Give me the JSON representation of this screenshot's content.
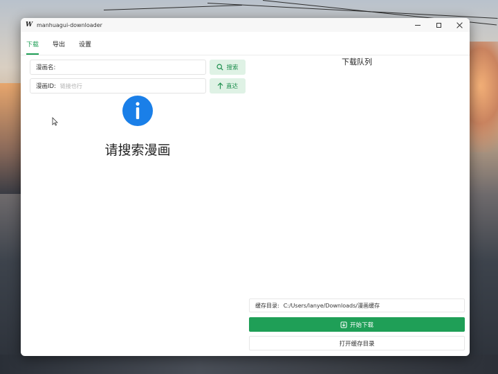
{
  "window": {
    "app_icon": "W",
    "title": "manhuagui-downloader"
  },
  "tabs": [
    {
      "label": "下载",
      "active": true
    },
    {
      "label": "导出",
      "active": false
    },
    {
      "label": "设置",
      "active": false
    }
  ],
  "search": {
    "name_label": "漫画名:",
    "name_value": "",
    "name_placeholder": "",
    "search_button": "搜索",
    "id_label": "漫画ID:",
    "id_placeholder": "链接也行",
    "direct_button": "直达"
  },
  "empty_state": {
    "icon": "info-icon",
    "message": "请搜索漫画"
  },
  "queue": {
    "title": "下载队列"
  },
  "cache": {
    "label": "缓存目录:",
    "path": "C:/Users/lanye/Downloads/漫画缓存"
  },
  "actions": {
    "start_download": "开始下载",
    "open_cache_dir": "打开缓存目录"
  },
  "colors": {
    "accent": "#1e9e55",
    "info_blue": "#1a7fe8",
    "button_tint": "#dff2e5"
  }
}
